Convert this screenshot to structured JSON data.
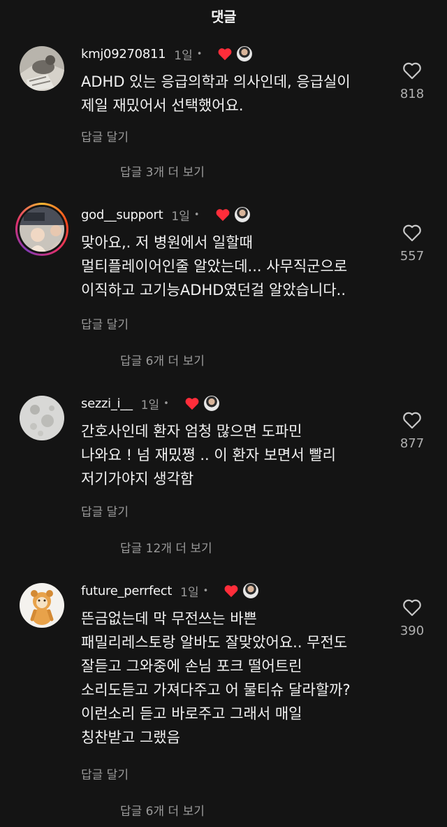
{
  "header": {
    "title": "댓글"
  },
  "comments": [
    {
      "username": "kmj09270811",
      "time": "1일",
      "dot": "•",
      "lines": [
        "ADHD 있는 응급의학과 의사인데, 응급실이",
        "제일 재밌어서 선택했어요."
      ],
      "reply_label": "답글 달기",
      "view_replies": "답글 3개 더 보기",
      "likes": "818"
    },
    {
      "username": "god__support",
      "time": "1일",
      "dot": "•",
      "lines": [
        "맞아요,. 저 병원에서 일할때",
        "멀티플레이어인줄 알았는데... 사무직군으로",
        "이직하고 고기능ADHD였던걸 알았습니다.."
      ],
      "reply_label": "답글 달기",
      "view_replies": "답글 6개 더 보기",
      "likes": "557"
    },
    {
      "username": "sezzi_i__",
      "time": "1일",
      "dot": "•",
      "lines": [
        "간호사인데 환자 엄청 많으면 도파민",
        "나와요 ! 넘 재밌쪙 .. 이 환자 보면서 빨리",
        "저기가야지 생각함"
      ],
      "reply_label": "답글 달기",
      "view_replies": "답글 12개 더 보기",
      "likes": "877"
    },
    {
      "username": "future_perrfect",
      "time": "1일",
      "dot": "•",
      "lines": [
        "뜬금없는데 막 무전쓰는 바쁜",
        "패밀리레스토랑 알바도 잘맞았어요.. 무전도",
        "잘듣고 그와중에 손님 포크 떨어트린",
        "소리도듣고 가져다주고 어 물티슈 달라할까?",
        "이런소리 듣고 바로주고 그래서 매일",
        "칭찬받고 그랬음"
      ],
      "reply_label": "답글 달기",
      "view_replies": "답글 6개 더 보기",
      "likes": "390"
    }
  ],
  "colors": {
    "background": "#141414",
    "text": "#f5f5f5",
    "muted": "#9a9a9a",
    "heart": "#ff2d3a"
  },
  "icons": {
    "like": "heart-outline-icon",
    "creator_liked": "heart-filled-icon"
  }
}
